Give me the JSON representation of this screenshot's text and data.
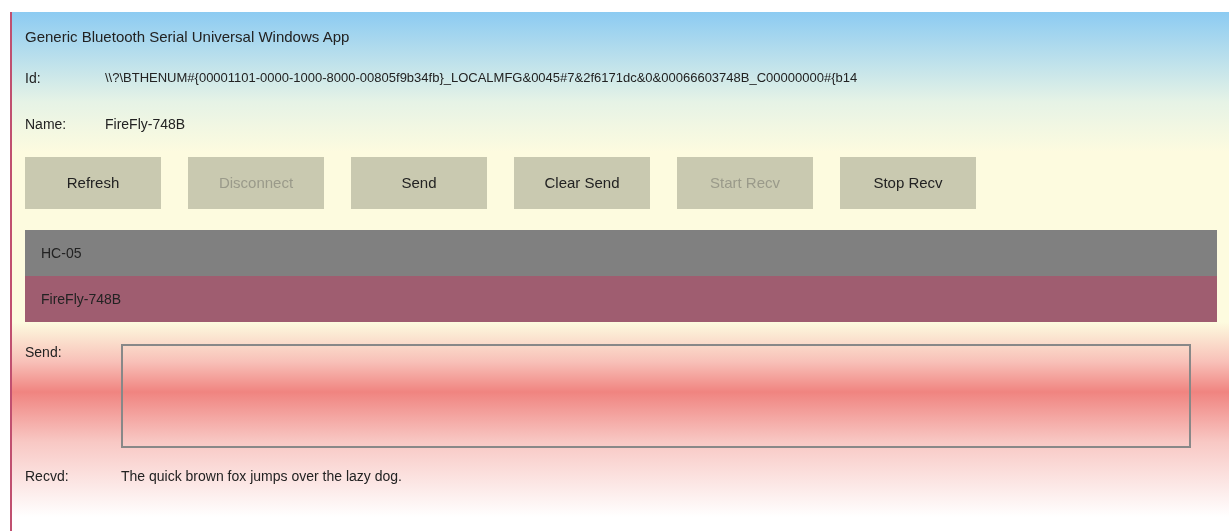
{
  "window": {
    "title": "Generic Bluetooth Serial Universal Windows App"
  },
  "id": {
    "label": "Id:",
    "value": "\\\\?\\BTHENUM#{00001101-0000-1000-8000-00805f9b34fb}_LOCALMFG&0045#7&2f6171dc&0&00066603748B_C00000000#{b14"
  },
  "name": {
    "label": "Name:",
    "value": "FireFly-748B"
  },
  "buttons": [
    {
      "label": "Refresh",
      "disabled": false
    },
    {
      "label": "Disconnect",
      "disabled": true
    },
    {
      "label": "Send",
      "disabled": false
    },
    {
      "label": "Clear Send",
      "disabled": false
    },
    {
      "label": "Start Recv",
      "disabled": true
    },
    {
      "label": "Stop Recv",
      "disabled": false
    }
  ],
  "devices": [
    {
      "name": "HC-05",
      "selected": false
    },
    {
      "name": "FireFly-748B",
      "selected": true
    }
  ],
  "send": {
    "label": "Send:"
  },
  "recvd": {
    "label": "Recvd:",
    "value": "The quick brown fox jumps over the lazy dog."
  }
}
